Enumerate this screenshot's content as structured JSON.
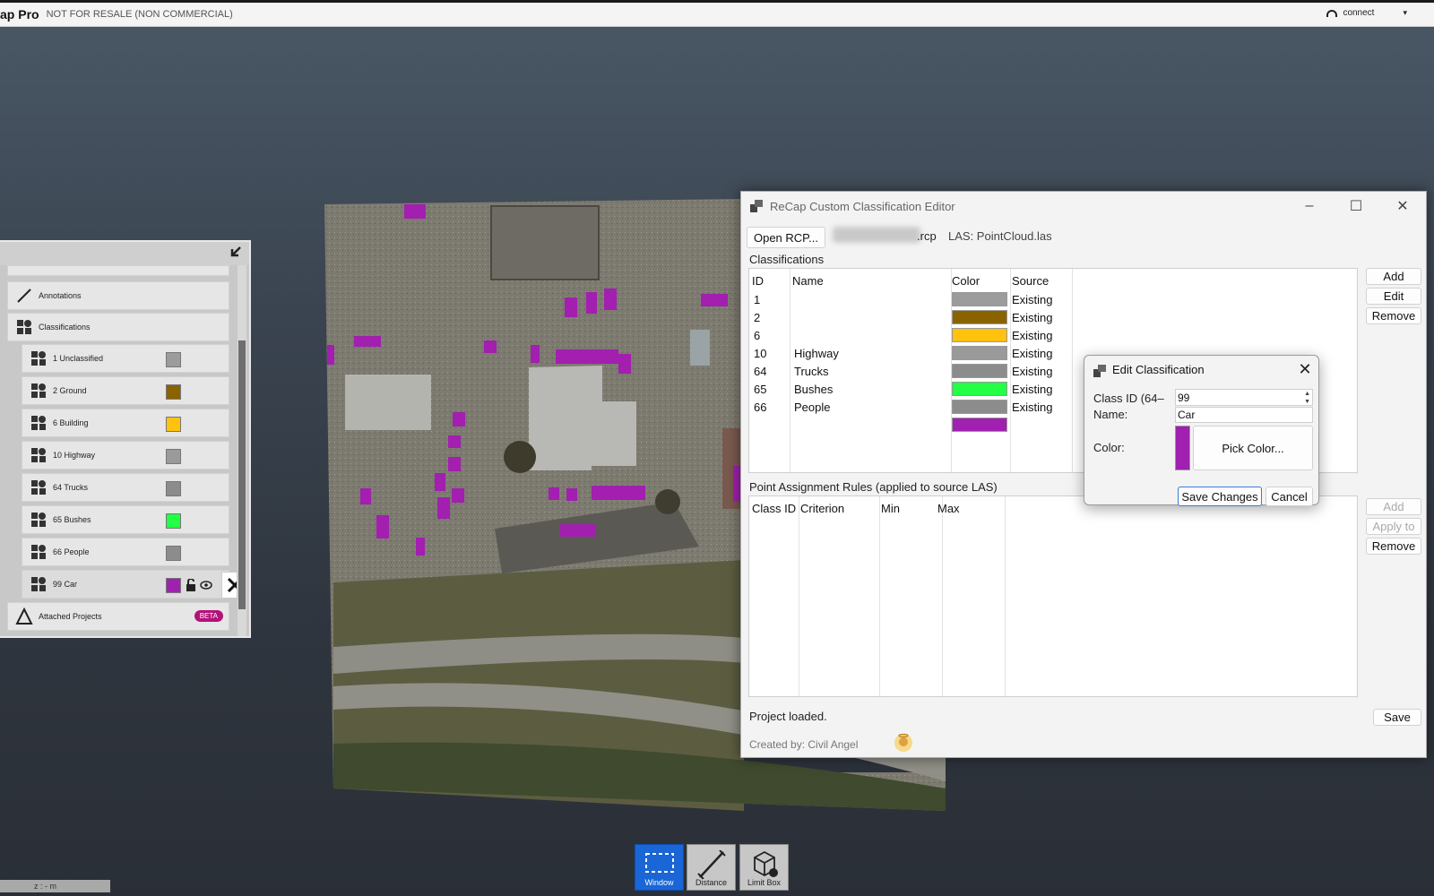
{
  "app": {
    "name": "ap Pro",
    "license_note": "NOT FOR RESALE (NON COMMERCIAL)",
    "connect_label": "connect"
  },
  "left_panel": {
    "items": [
      {
        "label": "Annotations",
        "icon": "ruler-icon"
      },
      {
        "label": "Classifications",
        "icon": "classification-icon"
      }
    ],
    "classes": [
      {
        "label": "1 Unclassified",
        "color": "#9c9c9c"
      },
      {
        "label": "2 Ground",
        "color": "#8a6300"
      },
      {
        "label": "6 Building",
        "color": "#ffc20e"
      },
      {
        "label": "10 Highway",
        "color": "#9a9a9a"
      },
      {
        "label": "64 Trucks",
        "color": "#8c8c8c"
      },
      {
        "label": "65 Bushes",
        "color": "#22ff44"
      },
      {
        "label": "66 People",
        "color": "#8c8c8c"
      },
      {
        "label": "99 Car",
        "color": "#a020b0"
      }
    ],
    "attached_projects": "Attached Projects",
    "beta_badge": "BETA"
  },
  "editor": {
    "title": "ReCap Custom Classification Editor",
    "open_button": "Open RCP...",
    "rcp_suffix": ".rcp",
    "las_label": "LAS: PointCloud.las",
    "classifications_label": "Classifications",
    "columns": [
      "ID",
      "Name",
      "Color",
      "Source"
    ],
    "rows": [
      {
        "id": "1",
        "name": "",
        "color": "#9c9c9c",
        "source": "Existing"
      },
      {
        "id": "2",
        "name": "",
        "color": "#8a6300",
        "source": "Existing"
      },
      {
        "id": "6",
        "name": "",
        "color": "#ffc20e",
        "source": "Existing"
      },
      {
        "id": "10",
        "name": "Highway",
        "color": "#9a9a9a",
        "source": "Existing"
      },
      {
        "id": "64",
        "name": "Trucks",
        "color": "#8c8c8c",
        "source": "Existing"
      },
      {
        "id": "65",
        "name": "Bushes",
        "color": "#22ff44",
        "source": "Existing"
      },
      {
        "id": "66",
        "name": "People",
        "color": "#8c8c8c",
        "source": "Existing"
      },
      {
        "id": "",
        "name": "",
        "color": "#a020b0",
        "source": ""
      }
    ],
    "class_buttons": {
      "add": "Add",
      "edit": "Edit",
      "remove": "Remove"
    },
    "rules_label": "Point Assignment Rules (applied to source LAS)",
    "rules_columns": [
      "Class ID",
      "Criterion",
      "Min",
      "Max"
    ],
    "rule_buttons": {
      "add": "Add",
      "apply": "Apply to",
      "remove": "Remove"
    },
    "status": "Project loaded.",
    "save_button": "Save",
    "credit": "Created by: Civil Angel"
  },
  "dialog": {
    "title": "Edit Classification",
    "class_id_label": "Class ID (64–",
    "class_id_value": "99",
    "name_label": "Name:",
    "name_value": "Car",
    "color_label": "Color:",
    "color_value": "#a020b0",
    "pick_color": "Pick Color...",
    "save": "Save Changes",
    "cancel": "Cancel"
  },
  "toolbar": {
    "window": "Window",
    "distance": "Distance",
    "limit_box": "Limit Box"
  },
  "status_bar": "z : - m"
}
